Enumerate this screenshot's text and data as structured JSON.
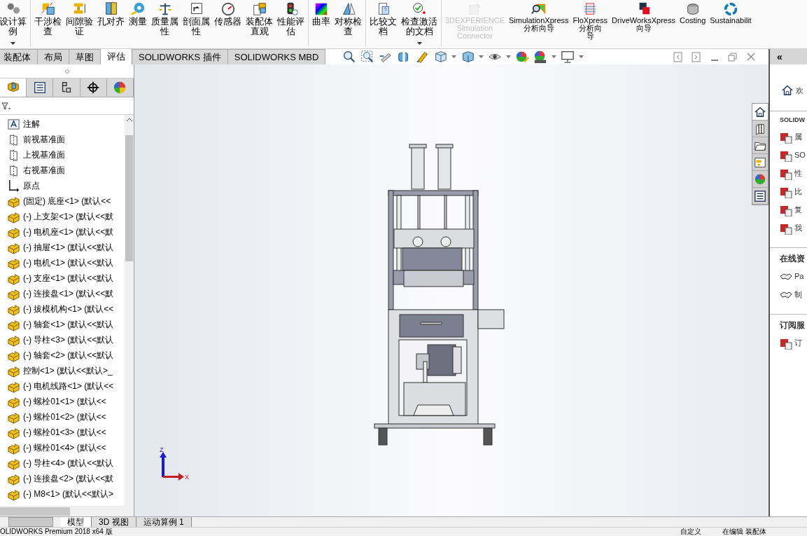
{
  "ribbon": {
    "groups": [
      [
        {
          "lines": [
            "设计算",
            "例"
          ],
          "disabled": false,
          "has_menu": true
        }
      ],
      [
        {
          "lines": [
            "干涉检",
            "查"
          ],
          "disabled": false
        },
        {
          "lines": [
            "间隙验",
            "证"
          ],
          "disabled": false
        },
        {
          "lines": [
            "孔对齐"
          ],
          "disabled": false
        },
        {
          "lines": [
            "测量"
          ],
          "disabled": false
        },
        {
          "lines": [
            "质量属",
            "性"
          ],
          "disabled": false
        },
        {
          "lines": [
            "剖面属",
            "性"
          ],
          "disabled": false
        },
        {
          "lines": [
            "传感器"
          ],
          "disabled": false
        },
        {
          "lines": [
            "装配体",
            "直观"
          ],
          "disabled": false
        },
        {
          "lines": [
            "性能评",
            "估"
          ],
          "disabled": false
        }
      ],
      [
        {
          "lines": [
            "曲率"
          ],
          "disabled": false
        },
        {
          "lines": [
            "对称检",
            "查"
          ],
          "disabled": false
        }
      ],
      [
        {
          "lines": [
            "比较文",
            "档"
          ],
          "disabled": false
        },
        {
          "lines": [
            "检查激活",
            "的文档"
          ],
          "disabled": false,
          "has_menu": true
        }
      ],
      [
        {
          "lines": [
            "3DEXPERIENCE",
            "Simulation",
            "Connector"
          ],
          "disabled": true
        },
        {
          "lines": [
            "SimulationXpress",
            "分析向导"
          ],
          "disabled": false
        },
        {
          "lines": [
            "FloXpress",
            "分析向",
            "导"
          ],
          "disabled": false
        },
        {
          "lines": [
            "DriveWorksXpress",
            "向导"
          ],
          "disabled": false
        },
        {
          "lines": [
            "Costing"
          ],
          "disabled": false
        },
        {
          "lines": [
            "Sustainabilit"
          ],
          "disabled": false
        }
      ]
    ]
  },
  "command_tabs": [
    {
      "label": "装配体",
      "selected": false
    },
    {
      "label": "布局",
      "selected": false
    },
    {
      "label": "草图",
      "selected": false
    },
    {
      "label": "评估",
      "selected": true
    },
    {
      "label": "SOLIDWORKS 插件",
      "selected": false
    },
    {
      "label": "SOLIDWORKS MBD",
      "selected": false
    }
  ],
  "panel_tabs": [
    {
      "selected": true
    },
    {
      "selected": false
    },
    {
      "selected": false
    },
    {
      "selected": false
    },
    {
      "selected": false
    }
  ],
  "feature_tree": [
    {
      "kind": "annotation",
      "label": "注解"
    },
    {
      "kind": "plane",
      "label": "前视基准面"
    },
    {
      "kind": "plane",
      "label": "上视基准面"
    },
    {
      "kind": "plane",
      "label": "右视基准面"
    },
    {
      "kind": "origin",
      "label": "原点"
    },
    {
      "kind": "part",
      "label": "(固定) 底座<1> (默认<<"
    },
    {
      "kind": "part",
      "label": "(-) 上支架<1> (默认<<默"
    },
    {
      "kind": "part",
      "label": "(-) 电机座<1> (默认<<默"
    },
    {
      "kind": "part",
      "label": "(-) 抽屉<1> (默认<<默认"
    },
    {
      "kind": "part",
      "label": "(-) 电机<1> (默认<<默认"
    },
    {
      "kind": "part",
      "label": "(-) 支座<1> (默认<<默认"
    },
    {
      "kind": "part",
      "label": "(-) 连接盘<1> (默认<<默"
    },
    {
      "kind": "part",
      "label": "(-) 拔模机构<1> (默认<<"
    },
    {
      "kind": "part",
      "label": "(-) 轴套<1> (默认<<默认"
    },
    {
      "kind": "part",
      "label": "(-) 导柱<3> (默认<<默认"
    },
    {
      "kind": "part",
      "label": "(-) 轴套<2> (默认<<默认"
    },
    {
      "kind": "part",
      "label": "控制<1> (默认<<默认>_"
    },
    {
      "kind": "part",
      "label": "(-) 电机线路<1> (默认<<"
    },
    {
      "kind": "part",
      "label": "(-) 螺栓01<1> (默认<<"
    },
    {
      "kind": "part",
      "label": "(-) 螺栓01<2> (默认<<"
    },
    {
      "kind": "part",
      "label": "(-) 螺栓01<3> (默认<<"
    },
    {
      "kind": "part",
      "label": "(-) 螺栓01<4> (默认<<"
    },
    {
      "kind": "part",
      "label": "(-) 导柱<4> (默认<<默认"
    },
    {
      "kind": "part",
      "label": "(-) 连接盘<2> (默认<<默"
    },
    {
      "kind": "part",
      "label": "(-) M8<1> (默认<<默认>"
    }
  ],
  "triad": {
    "z": "Z",
    "x": "X"
  },
  "task_pane": {
    "collapse": "«",
    "tabs": [
      {
        "selected": true
      },
      {
        "selected": false
      },
      {
        "selected": false
      },
      {
        "selected": false
      },
      {
        "selected": false
      },
      {
        "selected": false
      }
    ],
    "welcome": "欢",
    "sections": [
      {
        "title": "SOLIDW",
        "items": [
          "属",
          "SO",
          "性",
          "比",
          "复",
          "我"
        ]
      },
      {
        "title": "在线资",
        "items": [
          "Pa",
          "制"
        ]
      },
      {
        "title": "订阅服",
        "items": [
          "订"
        ]
      }
    ]
  },
  "bottom_tabs": [
    {
      "label": "模型",
      "selected": true
    },
    {
      "label": "3D 视图",
      "selected": false
    },
    {
      "label": "运动算例 1",
      "selected": false
    }
  ],
  "status_bar": {
    "product": "OLIDWORKS Premium 2018 x64 版",
    "units": "自定义",
    "mode": "在编辑 装配体"
  }
}
